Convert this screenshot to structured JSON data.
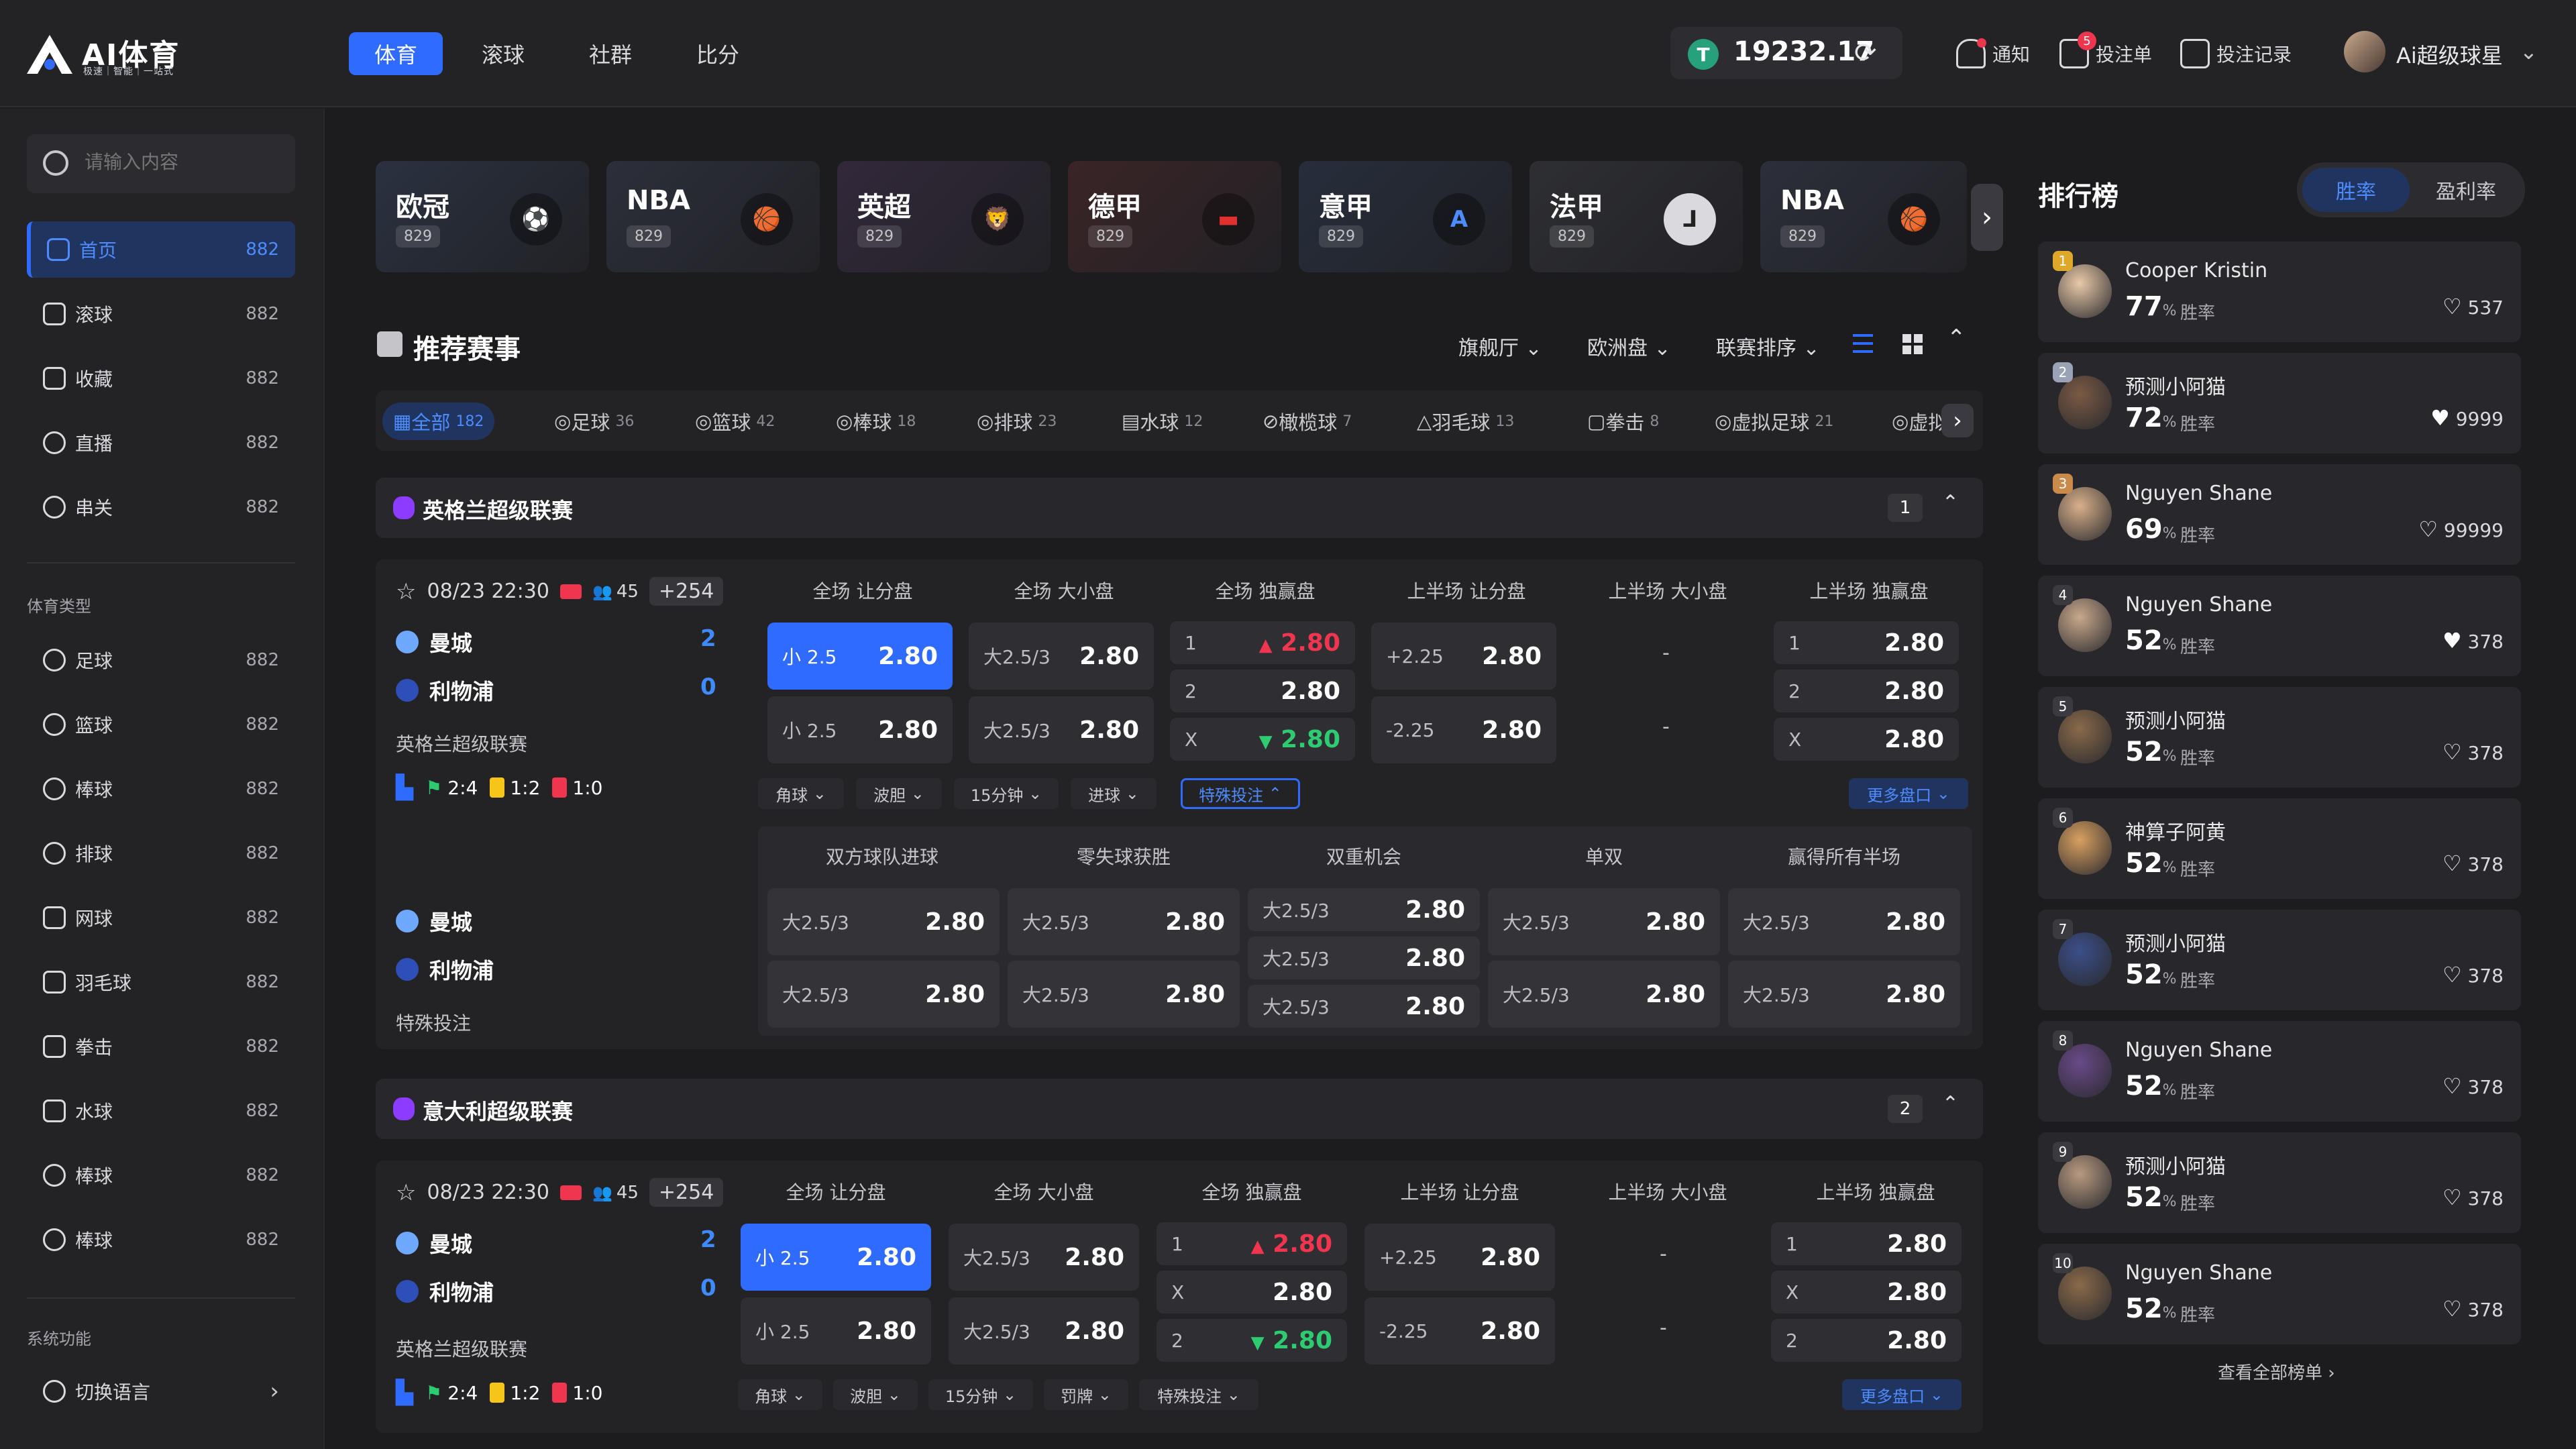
{
  "brand": {
    "name": "AI体育",
    "slogan": "极速｜智能｜一站式"
  },
  "nav": {
    "tabs": [
      "体育",
      "滚球",
      "社群",
      "比分"
    ]
  },
  "wallet": {
    "currency_symbol": "T",
    "balance": "19232.17"
  },
  "top_actions": {
    "notify": "通知",
    "betslip": "投注单",
    "betslip_badge": "5",
    "records": "投注记录"
  },
  "user": {
    "name": "Ai超级球星"
  },
  "search": {
    "placeholder": "请输入内容"
  },
  "sidebar": {
    "main": [
      {
        "label": "首页",
        "count": "882"
      },
      {
        "label": "滚球",
        "count": "882"
      },
      {
        "label": "收藏",
        "count": "882"
      },
      {
        "label": "直播",
        "count": "882"
      },
      {
        "label": "串关",
        "count": "882"
      }
    ],
    "sports_title": "体育类型",
    "sports": [
      {
        "label": "足球",
        "count": "882"
      },
      {
        "label": "篮球",
        "count": "882"
      },
      {
        "label": "棒球",
        "count": "882"
      },
      {
        "label": "排球",
        "count": "882"
      },
      {
        "label": "网球",
        "count": "882"
      },
      {
        "label": "羽毛球",
        "count": "882"
      },
      {
        "label": "拳击",
        "count": "882"
      },
      {
        "label": "水球",
        "count": "882"
      },
      {
        "label": "棒球",
        "count": "882"
      },
      {
        "label": "棒球",
        "count": "882"
      }
    ],
    "system_title": "系统功能",
    "system": [
      {
        "label": "切换语言"
      }
    ]
  },
  "league_cards": [
    {
      "name": "欧冠",
      "count": "829",
      "bg": "#2a3140",
      "icon": "⚽"
    },
    {
      "name": "NBA",
      "count": "829",
      "bg": "#2c2f3a",
      "icon": "🏀"
    },
    {
      "name": "英超",
      "count": "829",
      "bg": "#32283a",
      "icon": "🦁"
    },
    {
      "name": "德甲",
      "count": "829",
      "bg": "#3a2426",
      "icon": "▬"
    },
    {
      "name": "意甲",
      "count": "829",
      "bg": "#262e3c",
      "icon": "A"
    },
    {
      "name": "法甲",
      "count": "829",
      "bg": "#2e2f33",
      "icon": "⅃"
    },
    {
      "name": "NBA",
      "count": "829",
      "bg": "#2c2f3a",
      "icon": "🏀"
    }
  ],
  "section": {
    "title": "推荐赛事",
    "filters": [
      "旗舰厅",
      "欧洲盘",
      "联赛排序"
    ]
  },
  "sport_tabs": [
    {
      "label": "全部",
      "count": "182"
    },
    {
      "label": "足球",
      "count": "36"
    },
    {
      "label": "篮球",
      "count": "42"
    },
    {
      "label": "棒球",
      "count": "18"
    },
    {
      "label": "排球",
      "count": "23"
    },
    {
      "label": "水球",
      "count": "12"
    },
    {
      "label": "橄榄球",
      "count": "7"
    },
    {
      "label": "羽毛球",
      "count": "13"
    },
    {
      "label": "拳击",
      "count": "8"
    },
    {
      "label": "虚拟足球",
      "count": "21"
    },
    {
      "label": "虚拟",
      "count": ""
    }
  ],
  "leagues": [
    {
      "title": "英格兰超级联赛",
      "num": "1"
    },
    {
      "title": "意大利超级联赛",
      "num": "2"
    }
  ],
  "match": {
    "time": "08/23 22:30",
    "viewers": "45",
    "more": "+254",
    "home": "曼城",
    "away": "利物浦",
    "home_score": "2",
    "away_score": "0",
    "league": "英格兰超级联赛",
    "stat_corner": "2:4",
    "stat_yellow": "1:2",
    "stat_red": "1:0",
    "col_headers": [
      "全场 让分盘",
      "全场 大小盘",
      "全场 独赢盘",
      "上半场 让分盘",
      "上半场 大小盘",
      "上半场 独赢盘"
    ],
    "hcap_line1": "小 2.5",
    "hcap_odd1": "2.80",
    "hcap_line2": "小 2.5",
    "hcap_odd2": "2.80",
    "ou_line": "大2.5/3",
    "ou_odd": "2.80",
    "mr_1": "1",
    "mr_2": "2",
    "mr_x": "X",
    "mr_odd": "2.80",
    "fh_hcap_line1": "+2.25",
    "fh_hcap_line2": "-2.25",
    "fh_odd": "2.80",
    "dash": "-",
    "dropdowns": [
      "角球",
      "波胆",
      "15分钟",
      "进球",
      "特殊投注"
    ],
    "dropdowns2": [
      "角球",
      "波胆",
      "15分钟",
      "罚牌",
      "特殊投注"
    ],
    "more_markets": "更多盘口",
    "special_label": "特殊投注",
    "special_headers": [
      "双方球队进球",
      "零失球获胜",
      "双重机会",
      "单双",
      "赢得所有半场"
    ],
    "special_line": "大2.5/3",
    "special_odd": "2.80"
  },
  "ranking": {
    "title": "排行榜",
    "tabs": [
      "胜率",
      "盈利率"
    ],
    "win_label": "胜率",
    "pct_unit": "%",
    "rows": [
      {
        "pos": "1",
        "name": "Cooper Kristin",
        "pct": "77",
        "likes": "537",
        "pos_color": "#e0a82a",
        "av": "#e9c9a8"
      },
      {
        "pos": "2",
        "name": "预测小阿猫",
        "pct": "72",
        "likes": "9999",
        "pos_color": "#9aa3b5",
        "av": "#7a5a44"
      },
      {
        "pos": "3",
        "name": "Nguyen Shane",
        "pct": "69",
        "likes": "99999",
        "pos_color": "#c98a4a",
        "av": "#d8b08a"
      },
      {
        "pos": "4",
        "name": "Nguyen Shane",
        "pct": "52",
        "likes": "378",
        "pos_color": "#3a3a40",
        "av": "#c9a98c"
      },
      {
        "pos": "5",
        "name": "预测小阿猫",
        "pct": "52",
        "likes": "378",
        "pos_color": "#3a3a40",
        "av": "#8a6a4a"
      },
      {
        "pos": "6",
        "name": "神算子阿黄",
        "pct": "52",
        "likes": "378",
        "pos_color": "#3a3a40",
        "av": "#d9a060"
      },
      {
        "pos": "7",
        "name": "预测小阿猫",
        "pct": "52",
        "likes": "378",
        "pos_color": "#3a3a40",
        "av": "#3b4f8a"
      },
      {
        "pos": "8",
        "name": "Nguyen Shane",
        "pct": "52",
        "likes": "378",
        "pos_color": "#3a3a40",
        "av": "#6a4a8a"
      },
      {
        "pos": "9",
        "name": "预测小阿猫",
        "pct": "52",
        "likes": "378",
        "pos_color": "#3a3a40",
        "av": "#b89a80"
      },
      {
        "pos": "10",
        "name": "Nguyen Shane",
        "pct": "52",
        "likes": "378",
        "pos_color": "#3a3a40",
        "av": "#8a6a4a"
      }
    ],
    "view_all": "查看全部榜单"
  }
}
